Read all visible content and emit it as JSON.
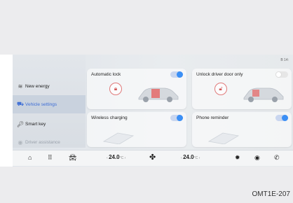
{
  "sidebar": {
    "items": [
      {
        "label": "",
        "icon": "",
        "state": "faded"
      },
      {
        "label": "New energy",
        "icon": "energy-icon",
        "state": "normal"
      },
      {
        "label": "Vehicle settings",
        "icon": "vehicle-settings-icon",
        "state": "active"
      },
      {
        "label": "Smart key",
        "icon": "key-icon",
        "state": "normal"
      },
      {
        "label": "Driver assistance",
        "icon": "assist-icon",
        "state": "faded"
      }
    ]
  },
  "status": {
    "text": "B   14:"
  },
  "cards": [
    {
      "title": "Automatic lock",
      "toggle": "on",
      "icon": "lock-icon"
    },
    {
      "title": "Unlock driver door only",
      "toggle": "off",
      "icon": "unlock-icon"
    },
    {
      "title": "Wireless charging",
      "toggle": "on",
      "icon": ""
    },
    {
      "title": "Phone reminder",
      "toggle": "on",
      "icon": ""
    }
  ],
  "dock": {
    "left_temp": "24.0",
    "right_temp": "24.0",
    "temp_unit": "°C",
    "icons": [
      "home-icon",
      "apps-icon",
      "car-icon",
      "fan-icon",
      "settings-icon",
      "media-icon",
      "phone-icon"
    ]
  },
  "caption": "OMT1E-207"
}
